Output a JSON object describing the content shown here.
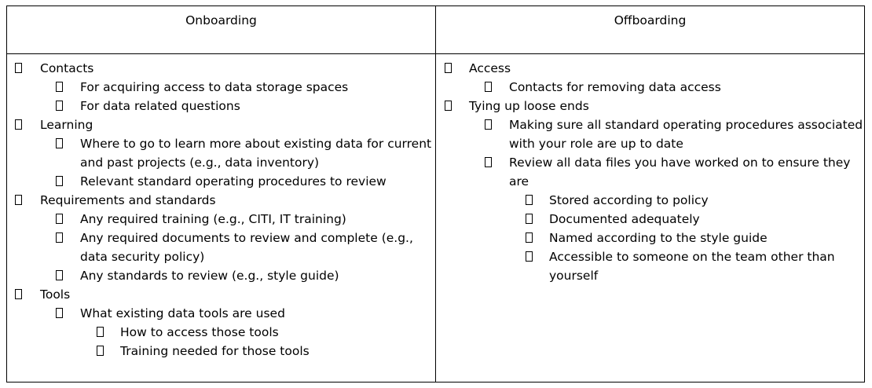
{
  "headers": {
    "left": "Onboarding",
    "right": "Offboarding"
  },
  "onboarding": [
    {
      "level": 0,
      "text": "Contacts"
    },
    {
      "level": 1,
      "text": "For acquiring access to data storage spaces"
    },
    {
      "level": 1,
      "text": "For data related questions"
    },
    {
      "level": 0,
      "text": "Learning"
    },
    {
      "level": 1,
      "text": "Where to go to learn more about existing data for current and past projects (e.g., data inventory)"
    },
    {
      "level": 1,
      "text": "Relevant standard operating procedures to review"
    },
    {
      "level": 0,
      "text": "Requirements and standards"
    },
    {
      "level": 1,
      "text": "Any required training (e.g., CITI, IT training)"
    },
    {
      "level": 1,
      "text": "Any required documents to review and complete (e.g., data security policy)"
    },
    {
      "level": 1,
      "text": "Any standards to review (e.g., style guide)"
    },
    {
      "level": 0,
      "text": "Tools"
    },
    {
      "level": 1,
      "text": "What existing data tools are used"
    },
    {
      "level": 2,
      "text": "How to access those tools"
    },
    {
      "level": 2,
      "text": "Training needed for those tools"
    }
  ],
  "offboarding": [
    {
      "level": 0,
      "text": "Access"
    },
    {
      "level": 1,
      "text": "Contacts for removing data access"
    },
    {
      "level": 0,
      "text": "Tying up loose ends"
    },
    {
      "level": 1,
      "text": "Making sure all standard operating procedures associated with your role are up to date"
    },
    {
      "level": 1,
      "text": "Review all data files you have worked on to ensure they are"
    },
    {
      "level": 2,
      "text": "Stored according to policy"
    },
    {
      "level": 2,
      "text": "Documented adequately"
    },
    {
      "level": 2,
      "text": "Named according to the style guide"
    },
    {
      "level": 2,
      "text": "Accessible to someone on the team other than yourself"
    }
  ]
}
